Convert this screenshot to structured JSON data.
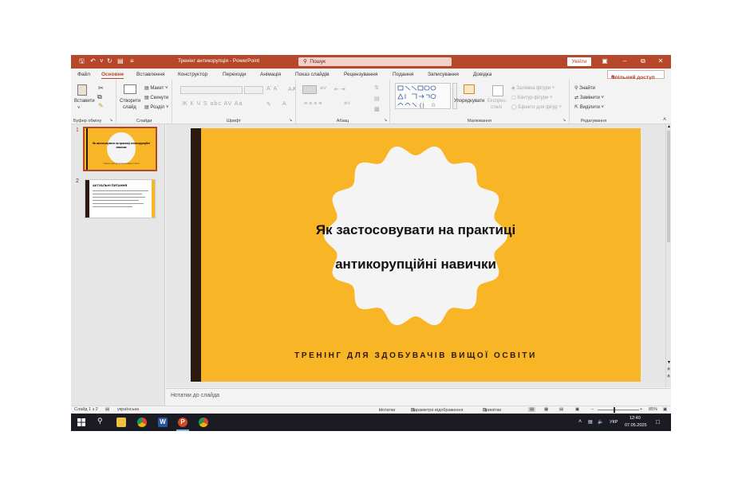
{
  "titlebar": {
    "title": "Тренінг антикорупція - PowerPoint",
    "search_placeholder": "Пошук",
    "signin": "Увійти"
  },
  "tabs": [
    "Файл",
    "Основне",
    "Вставлення",
    "Конструктор",
    "Переходи",
    "Анімація",
    "Показ слайдів",
    "Рецензування",
    "Подання",
    "Записування",
    "Довідка"
  ],
  "share_label": "Спільний доступ",
  "ribbon": {
    "clipboard": {
      "paste": "Вставити",
      "label": "Буфер обміну"
    },
    "slides": {
      "new_slide": "Створити слайд",
      "new_slide_1": "Створити",
      "new_slide_2": "слайд",
      "layout": "Макет",
      "reset": "Скинути",
      "section": "Розділ",
      "label": "Слайди"
    },
    "font": {
      "label": "Шрифт",
      "format_row": "Ж  К  Ч  S  abc  AV  Aa"
    },
    "paragraph": {
      "label": "Абзац"
    },
    "drawing": {
      "arrange": "Упорядкувати",
      "styles_1": "Експрес-",
      "styles_2": "стилі",
      "fill": "Заливка фігури",
      "outline": "Контур фігури",
      "effects": "Ефекти для фігур",
      "label": "Малювання"
    },
    "editing": {
      "find": "Знайти",
      "replace": "Замінити",
      "select": "Виділити",
      "label": "Редагування"
    }
  },
  "thumbnails": [
    {
      "num": "1",
      "title": "Як застосовувати на практиці антикорупційні навички",
      "subtitle": "ТРЕНІНГ ДЛЯ ЗДОБУВАЧІВ ВИЩОЇ ОСВІТИ"
    },
    {
      "num": "2",
      "title": "АКТУАЛЬНІ ПИТАННЯ"
    }
  ],
  "slide": {
    "title_line1": "Як  застосовувати на практиці",
    "title_line2": "антикорупційні навички",
    "subtitle": "ТРЕНІНГ ДЛЯ ЗДОБУВАЧІВ ВИЩОЇ ОСВІТИ",
    "colors": {
      "background": "#f8b626",
      "bar": "#2b1a0f",
      "badge": "#f4f4f4"
    }
  },
  "notes_placeholder": "Нотатки до слайда",
  "status": {
    "slide_info": "Слайд 1 з 2",
    "language": "українська",
    "notes": "Нотатки",
    "display_settings": "Параметри відображення",
    "comments": "Примітки",
    "zoom": "85%"
  },
  "taskbar": {
    "time": "12:40",
    "date": "07.05.2025",
    "lang": "УКР"
  }
}
